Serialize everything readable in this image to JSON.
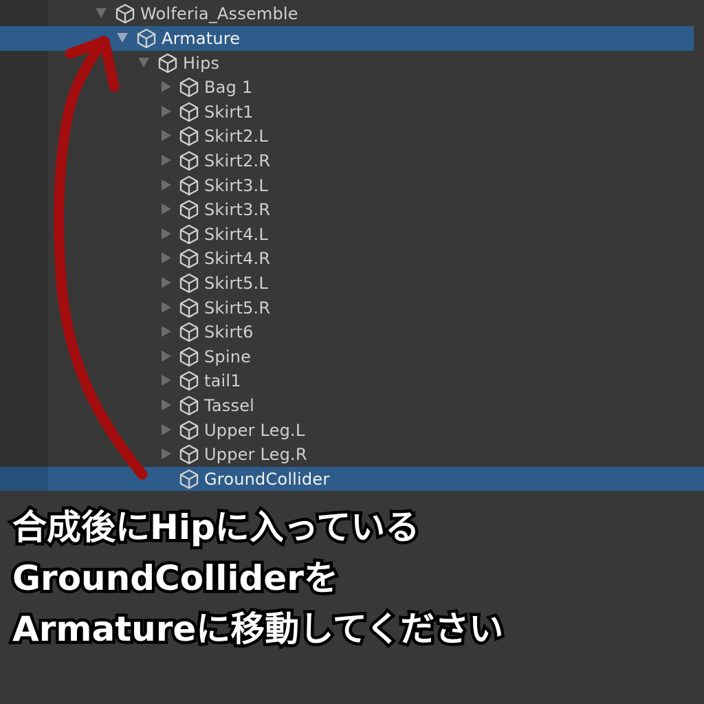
{
  "hierarchy": {
    "items": [
      {
        "label": "Wolferia_Assemble",
        "depth": 0,
        "state": "expanded",
        "selected": false
      },
      {
        "label": "Armature",
        "depth": 1,
        "state": "expanded",
        "selected": true
      },
      {
        "label": "Hips",
        "depth": 2,
        "state": "expanded",
        "selected": false
      },
      {
        "label": "Bag 1",
        "depth": 3,
        "state": "collapsed",
        "selected": false
      },
      {
        "label": "Skirt1",
        "depth": 3,
        "state": "collapsed",
        "selected": false
      },
      {
        "label": "Skirt2.L",
        "depth": 3,
        "state": "collapsed",
        "selected": false
      },
      {
        "label": "Skirt2.R",
        "depth": 3,
        "state": "collapsed",
        "selected": false
      },
      {
        "label": "Skirt3.L",
        "depth": 3,
        "state": "collapsed",
        "selected": false
      },
      {
        "label": "Skirt3.R",
        "depth": 3,
        "state": "collapsed",
        "selected": false
      },
      {
        "label": "Skirt4.L",
        "depth": 3,
        "state": "collapsed",
        "selected": false
      },
      {
        "label": "Skirt4.R",
        "depth": 3,
        "state": "collapsed",
        "selected": false
      },
      {
        "label": "Skirt5.L",
        "depth": 3,
        "state": "collapsed",
        "selected": false
      },
      {
        "label": "Skirt5.R",
        "depth": 3,
        "state": "collapsed",
        "selected": false
      },
      {
        "label": "Skirt6",
        "depth": 3,
        "state": "collapsed",
        "selected": false
      },
      {
        "label": "Spine",
        "depth": 3,
        "state": "collapsed",
        "selected": false
      },
      {
        "label": "tail1",
        "depth": 3,
        "state": "collapsed",
        "selected": false
      },
      {
        "label": "Tassel",
        "depth": 3,
        "state": "collapsed",
        "selected": false
      },
      {
        "label": "Upper Leg.L",
        "depth": 3,
        "state": "collapsed",
        "selected": false
      },
      {
        "label": "Upper Leg.R",
        "depth": 3,
        "state": "collapsed",
        "selected": false
      },
      {
        "label": "GroundCollider",
        "depth": 3,
        "state": "leaf",
        "selected": true
      }
    ]
  },
  "colors": {
    "panel_bg": "#383838",
    "selection": "#2d5c8a",
    "text": "#cfcfcf",
    "arrow": "#a30d0d"
  },
  "caption": {
    "line1": "合成後にHipに入っている",
    "line2": "GroundColliderを",
    "line3": "Armatureに移動してください"
  }
}
